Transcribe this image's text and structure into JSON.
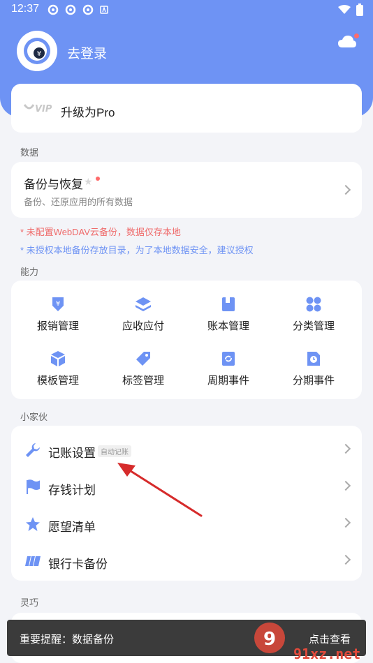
{
  "status": {
    "time": "12:37"
  },
  "user": {
    "login_label": "去登录"
  },
  "pro": {
    "vip_text": "VIP",
    "label": "升级为Pro"
  },
  "sections": {
    "data": "数据",
    "ability": "能力",
    "buddy": "小家伙",
    "lingqiao": "灵巧"
  },
  "backup": {
    "title": "备份与恢复",
    "subtitle": "备份、还原应用的所有数据"
  },
  "warnings": {
    "webdav": "* 未配置WebDAV云备份，数据仅存本地",
    "local": "* 未授权本地备份存放目录，为了本地数据安全，建议授权"
  },
  "ability_items": [
    {
      "label": "报销管理",
      "icon": "reimburse-icon"
    },
    {
      "label": "应收应付",
      "icon": "layers-icon"
    },
    {
      "label": "账本管理",
      "icon": "book-icon"
    },
    {
      "label": "分类管理",
      "icon": "category-grid-icon"
    },
    {
      "label": "模板管理",
      "icon": "cube-icon"
    },
    {
      "label": "标签管理",
      "icon": "tag-icon"
    },
    {
      "label": "周期事件",
      "icon": "cycle-icon"
    },
    {
      "label": "分期事件",
      "icon": "clock-file-icon"
    }
  ],
  "buddy_items": [
    {
      "label": "记账设置",
      "tag": "自动记账",
      "icon": "wrench-icon"
    },
    {
      "label": "存钱计划",
      "icon": "flag-icon"
    },
    {
      "label": "愿望清单",
      "icon": "star-icon"
    },
    {
      "label": "银行卡备份",
      "icon": "card-icon"
    }
  ],
  "toast": {
    "message": "重要提醒：数据备份",
    "action": "点击查看"
  },
  "watermark": {
    "text": "91xz.net"
  },
  "colors": {
    "primary": "#6e93f4",
    "warn": "#ef6b6b",
    "annotation_arrow": "#d62b2b"
  }
}
